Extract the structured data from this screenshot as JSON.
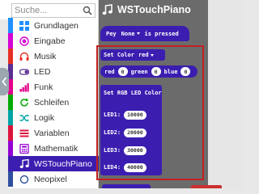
{
  "search": {
    "placeholder": "Suche..."
  },
  "categories": [
    {
      "label": "Grundlagen",
      "icon": "grid-icon",
      "color": "#1e90ff"
    },
    {
      "label": "Eingabe",
      "icon": "radio-circle-icon",
      "color": "#d400d4"
    },
    {
      "label": "Musik",
      "icon": "headphones-icon",
      "color": "#e63022"
    },
    {
      "label": "LED",
      "icon": "toggle-icon",
      "color": "#5c2d91"
    },
    {
      "label": "Funk",
      "icon": "signal-bars-icon",
      "color": "#e3008c"
    },
    {
      "label": "Schleifen",
      "icon": "refresh-icon",
      "color": "#00aa00"
    },
    {
      "label": "Logik",
      "icon": "shuffle-icon",
      "color": "#00a4a6"
    },
    {
      "label": "Variablen",
      "icon": "list-lines-icon",
      "color": "#dc143c"
    },
    {
      "label": "Mathematik",
      "icon": "calculator-icon",
      "color": "#9400d3"
    },
    {
      "label": "WSTouchPiano",
      "icon": "music-note-icon",
      "color": "#3b1eb0",
      "selected": true
    },
    {
      "label": "Neopixel",
      "icon": "circle-outline-icon",
      "color": "#2f4f9f"
    }
  ],
  "flyout": {
    "title": "WSTouchPiano",
    "block_pressed": {
      "prefix": "Pey",
      "dropdown": "None",
      "suffix": "is pressed"
    },
    "block_set_color": {
      "label": "Set Color",
      "dropdown": "red"
    },
    "block_rgb": {
      "red_label": "red",
      "red_value": "0",
      "green_label": "green",
      "green_value": "0",
      "blue_label": "blue",
      "blue_value": "0"
    },
    "block_rgb_led": {
      "label": "Set RGB LED Color",
      "leds": [
        {
          "label": "LED1:",
          "value": "10000"
        },
        {
          "label": "LED2:",
          "value": "20000"
        },
        {
          "label": "LED3:",
          "value": "30000"
        },
        {
          "label": "LED4:",
          "value": "40000"
        }
      ]
    }
  },
  "colors": {
    "block": "#3b1eb0",
    "flyout_bg": "#6b6b6b",
    "highlight": "#c21f1f"
  }
}
